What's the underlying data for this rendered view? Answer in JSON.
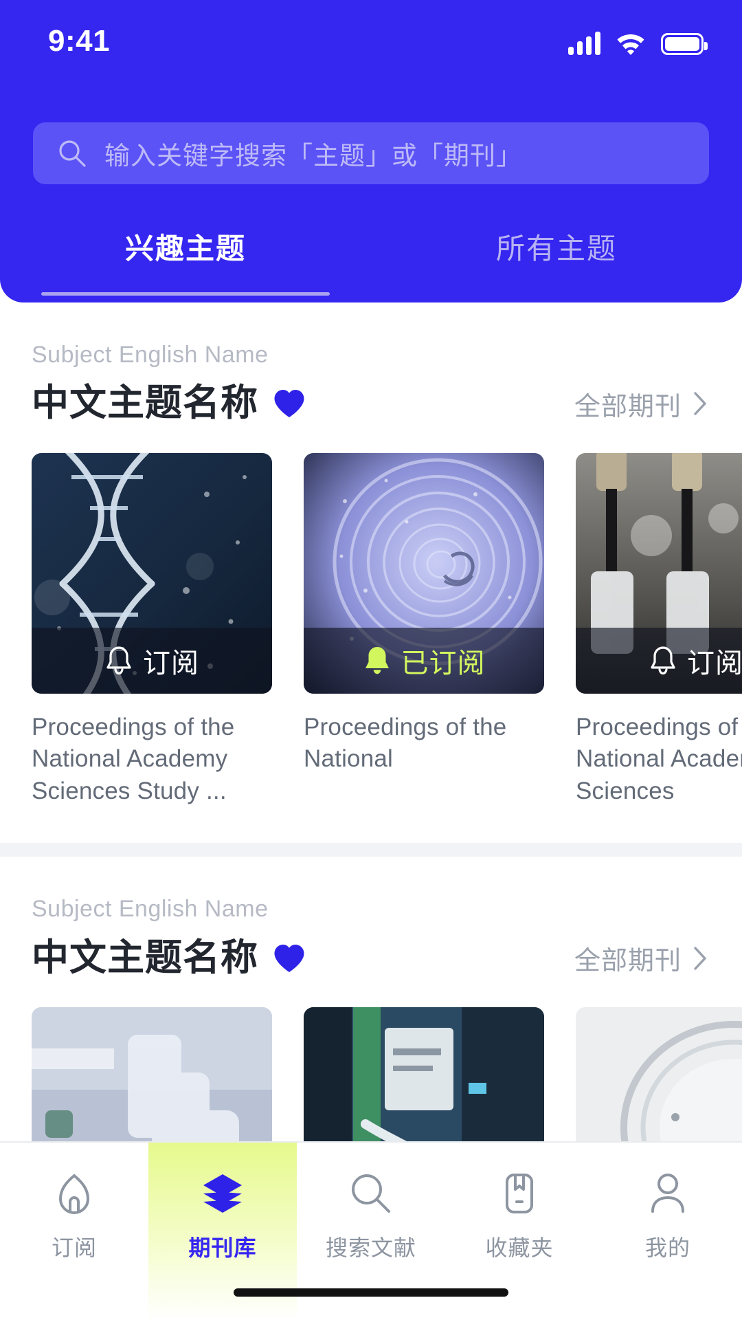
{
  "statusbar": {
    "time": "9:41",
    "signal_icon": "signal-bars-icon",
    "wifi_icon": "wifi-icon",
    "battery_icon": "battery-icon"
  },
  "colors": {
    "header_blue": "#3526F0",
    "search_field": "#5B53F6",
    "accent_blue": "#2F22E8",
    "lime": "#D2F75E",
    "muted_text": "#9AA1AC",
    "title_text": "#22262E",
    "card_title": "#636B78",
    "divider": "#F2F3F6"
  },
  "search": {
    "placeholder": "输入关键字搜索「主题」或「期刊」",
    "icon": "search-icon"
  },
  "tabs": [
    {
      "label": "兴趣主题",
      "active": true
    },
    {
      "label": "所有主题",
      "active": false
    }
  ],
  "sections": [
    {
      "english_name": "Subject English Name",
      "chinese_name": "中文主题名称",
      "favorite_icon": "heart-icon",
      "more_label": "全部期刊",
      "more_icon": "chevron-right-icon",
      "cards": [
        {
          "title": "Proceedings of the National Academy Sciences Study ...",
          "badge_label": "订阅",
          "badge_state": "unsubscribed",
          "badge_icon": "bell-outline-icon",
          "image": "dna-helix-photo"
        },
        {
          "title": "Proceedings of the National",
          "badge_label": "已订阅",
          "badge_state": "subscribed",
          "badge_icon": "bell-filled-icon",
          "image": "blue-swirl-photo"
        },
        {
          "title": "Proceedings of the National Academy Sciences",
          "badge_label": "订阅",
          "badge_state": "unsubscribed",
          "badge_icon": "bell-outline-icon",
          "image": "pipette-lab-photo"
        }
      ]
    },
    {
      "english_name": "Subject English Name",
      "chinese_name": "中文主题名称",
      "favorite_icon": "heart-icon",
      "more_label": "全部期刊",
      "more_icon": "chevron-right-icon",
      "cards": [
        {
          "title": "",
          "badge_label": "",
          "badge_state": "hidden",
          "image": "vials-photo"
        },
        {
          "title": "",
          "badge_label": "",
          "badge_state": "hidden",
          "image": "lab-machine-photo"
        },
        {
          "title": "",
          "badge_label": "",
          "badge_state": "hidden",
          "image": "petri-dish-photo"
        }
      ]
    }
  ],
  "bottom_nav": [
    {
      "label": "订阅",
      "icon": "home-icon",
      "active": false
    },
    {
      "label": "期刊库",
      "icon": "layers-icon",
      "active": true
    },
    {
      "label": "搜索文献",
      "icon": "search-icon",
      "active": false
    },
    {
      "label": "收藏夹",
      "icon": "bookmark-icon",
      "active": false
    },
    {
      "label": "我的",
      "icon": "person-icon",
      "active": false
    }
  ]
}
